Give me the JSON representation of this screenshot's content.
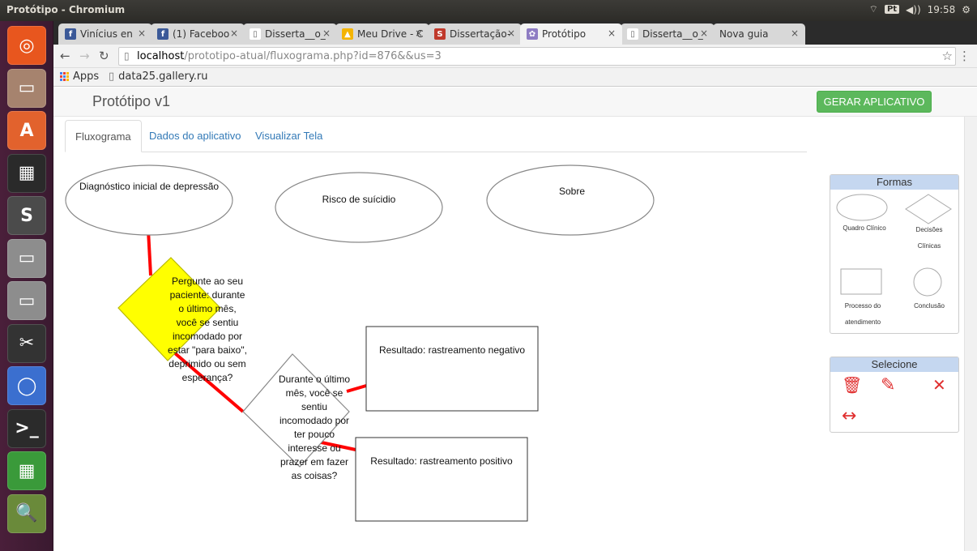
{
  "system_bar": {
    "window_title": "Protótipo - Chromium",
    "keyboard_layout": "Pt",
    "clock": "19:58"
  },
  "launcher": {
    "items": [
      {
        "name": "dash",
        "color": "#e8561e",
        "glyph": "◎"
      },
      {
        "name": "files",
        "color": "#a6836e",
        "glyph": "▭"
      },
      {
        "name": "software-center",
        "color": "#e2622d",
        "glyph": "A"
      },
      {
        "name": "app-grid",
        "color": "#2a2a2a",
        "glyph": "▦"
      },
      {
        "name": "sublime-text",
        "color": "#4b4b4b",
        "glyph": "S"
      },
      {
        "name": "drive-1",
        "color": "#8d8d8d",
        "glyph": "▭"
      },
      {
        "name": "drive-2",
        "color": "#8d8d8d",
        "glyph": "▭"
      },
      {
        "name": "video-editor",
        "color": "#333333",
        "glyph": "✂"
      },
      {
        "name": "chromium",
        "color": "#3b6fcf",
        "glyph": "◯"
      },
      {
        "name": "terminal",
        "color": "#2b2b2b",
        "glyph": ">_"
      },
      {
        "name": "spreadsheet",
        "color": "#3a9a3a",
        "glyph": "▦"
      },
      {
        "name": "image-viewer",
        "color": "#6a8a3a",
        "glyph": "🔍"
      }
    ]
  },
  "browser": {
    "tabs": [
      {
        "label": "Vinícius en",
        "icon": "facebook-icon",
        "color": "#3b5998",
        "glyph": "f"
      },
      {
        "label": "(1) Faceboo",
        "icon": "facebook-icon",
        "color": "#3b5998",
        "glyph": "f"
      },
      {
        "label": "Disserta__o_",
        "icon": "page-icon",
        "color": "#ffffff",
        "glyph": "▯"
      },
      {
        "label": "Meu Drive - C",
        "icon": "drive-icon",
        "color": "#f4b400",
        "glyph": "▲"
      },
      {
        "label": "Dissertação-",
        "icon": "sharelatex-icon",
        "color": "#c0392b",
        "glyph": "S"
      },
      {
        "label": "Protótipo",
        "icon": "prototype-icon",
        "color": "#8e7cc3",
        "glyph": "✿",
        "active": true
      },
      {
        "label": "Disserta__o_",
        "icon": "page-icon",
        "color": "#ffffff",
        "glyph": "▯"
      },
      {
        "label": "Nova guia",
        "icon": "none",
        "color": "",
        "glyph": ""
      }
    ],
    "url_host": "localhost",
    "url_path": "/prototipo-atual/fluxograma.php?id=876&&us=3",
    "bookmarks": [
      {
        "label": "Apps"
      },
      {
        "label": "data25.gallery.ru"
      }
    ]
  },
  "app": {
    "title": "Protótipo v1",
    "generate_button": "GERAR APLICATIVO",
    "tabs": [
      "Fluxograma",
      "Dados do aplicativo",
      "Visualizar Tela"
    ],
    "active_tab": "Fluxograma"
  },
  "flowchart": {
    "ellipse_1": "Diagnóstico inicial de depressão",
    "ellipse_2": "Risco de suícidio",
    "ellipse_3": "Sobre",
    "decision_1": "Pergunte ao seu paciente: durante o último mês, você se sentiu incomodado por estar \"para baixo\", deprimido ou sem esperança?",
    "decision_2": "Durante o último mês, você se sentiu incomodado por ter pouco interesse ou prazer em fazer as coisas?",
    "result_negative": "Resultado: rastreamento negativo",
    "result_positive": "Resultado: rastreamento positivo",
    "colors": {
      "decision_fill": "#ffff00",
      "connector": "#ff0000"
    }
  },
  "palette_formas": {
    "title": "Formas",
    "quadro_clinico": "Quadro Clínico",
    "decisoes_clinicas": "Decisões Clínicas",
    "processo_atendimento": "Processo do atendimento",
    "conclusao": "Conclusão"
  },
  "palette_selecione": {
    "title": "Selecione",
    "tools": [
      "trash-icon",
      "edit-icon",
      "resize-icon",
      "width-icon"
    ]
  }
}
